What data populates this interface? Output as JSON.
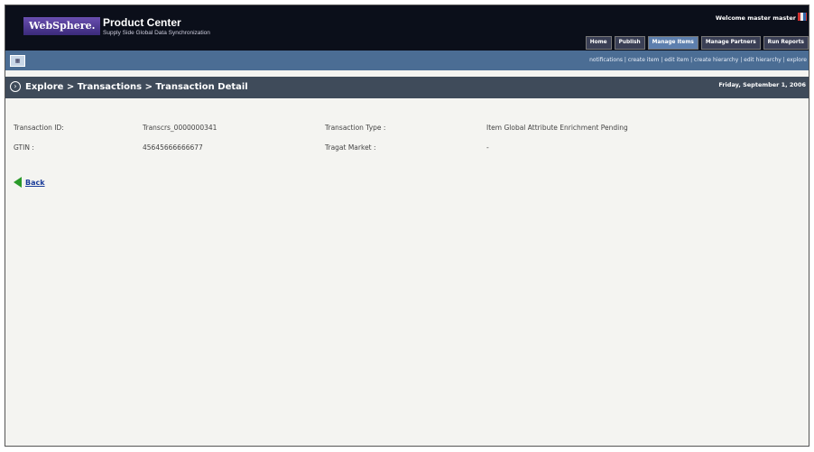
{
  "header": {
    "brand": "WebSphere.",
    "product_title": "Product Center",
    "product_subtitle": "Supply Side Global Data Synchronization",
    "welcome": "Welcome  master master",
    "tabs": [
      {
        "label": "Home",
        "active": false
      },
      {
        "label": "Publish",
        "active": false
      },
      {
        "label": "Manage Items",
        "active": true
      },
      {
        "label": "Manage Partners",
        "active": false
      },
      {
        "label": "Run Reports",
        "active": false
      }
    ]
  },
  "subnav": {
    "icon": "grid-icon",
    "links": [
      "notifications",
      "create item",
      "edit item",
      "create hierarchy",
      "edit hierarchy",
      "explore"
    ]
  },
  "breadcrumb": {
    "text": "Explore > Transactions > Transaction Detail",
    "date": "Friday, September 1, 2006"
  },
  "details": {
    "transaction_id_label": "Transaction ID:",
    "transaction_id_value": "Transcrs_0000000341",
    "transaction_type_label": "Transaction Type :",
    "transaction_type_value": "Item Global Attribute Enrichment Pending",
    "gtin_label": "GTIN :",
    "gtin_value": "45645666666677",
    "target_market_label": "Tragat Market :",
    "target_market_value": "-"
  },
  "back": {
    "label": "Back"
  },
  "colors": {
    "header_bg": "#0b0f1a",
    "subnav_bg": "#4b6d94",
    "crumb_bg": "#3f4b5a",
    "page_bg": "#f4f4f1",
    "back_arrow": "#2a9a2a"
  }
}
